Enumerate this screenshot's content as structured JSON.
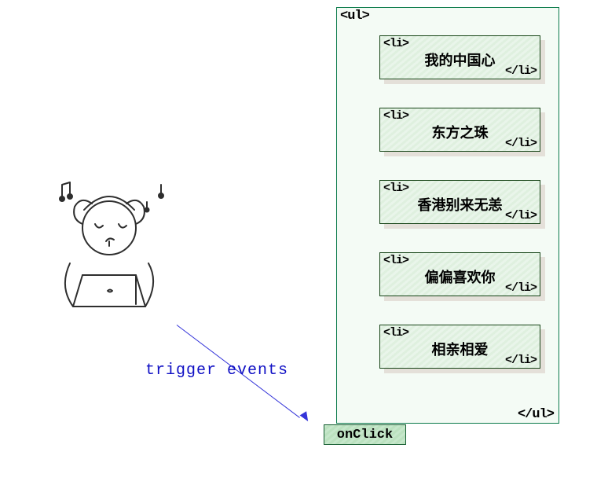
{
  "ul": {
    "open_tag": "<ul>",
    "close_tag": "</ul>",
    "li_open_tag": "<li>",
    "li_close_tag": "</li>",
    "items": [
      {
        "label": "我的中国心"
      },
      {
        "label": "东方之珠"
      },
      {
        "label": "香港别来无恙"
      },
      {
        "label": "偏偏喜欢你"
      },
      {
        "label": "相亲相爱"
      }
    ]
  },
  "arrow": {
    "label": "trigger  events"
  },
  "handler": {
    "label": "onClick"
  }
}
